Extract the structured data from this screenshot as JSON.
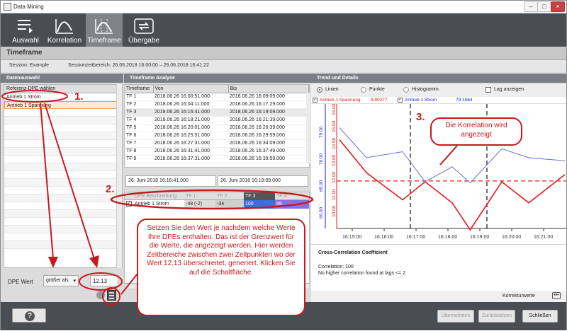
{
  "window": {
    "title": "Data Mining"
  },
  "toolbar": {
    "items": [
      {
        "label": "Auswahl"
      },
      {
        "label": "Korrelation"
      },
      {
        "label": "Timeframe"
      },
      {
        "label": "Übergabe"
      }
    ]
  },
  "page": {
    "title": "Timeframe"
  },
  "session": {
    "session_text": "Session: Example",
    "range_text": "Sessionzeitbereich: 26.06.2018 16:00:00 – 26.06.2018 16:41:22"
  },
  "left": {
    "title": "Datenauswahl",
    "column": "Referenz-DPE wählen",
    "items": [
      "Antrieb 1 Strom",
      "Antrieb 1 Spannung"
    ],
    "dpe_label": "DPE Wert",
    "operator_value": "größer als",
    "threshold_value": "12.13"
  },
  "middle": {
    "title": "Timeframe Analyse",
    "columns": [
      "Timeframe",
      "Von",
      "Bis"
    ],
    "rows": [
      [
        "TF 1",
        "2018.06.26 16:00:51.000",
        "2018.06.26 16:09:09.000"
      ],
      [
        "TF 2",
        "2018.06.26 16:04:11.000",
        "2018.06.26 16:17:29.000"
      ],
      [
        "TF 3",
        "2018.06.26 16:16:41.000",
        "2018.06.26 16:19:09.000"
      ],
      [
        "TF 4",
        "2018.06.26 16:18:21.000",
        "2018.06.26 16:21:39.000"
      ],
      [
        "TF 5",
        "2018.06.26 16:20:01.000",
        "2018.06.26 16:26:39.000"
      ],
      [
        "TF 6",
        "2018.06.26 16:25:51.000",
        "2018.06.26 16:29:59.000"
      ],
      [
        "TF 7",
        "2018.06.26 16:27:31.000",
        "2018.06.26 16:34:09.000"
      ],
      [
        "TF 8",
        "2018.06.26 16:31:41.000",
        "2018.06.26 16:37:49.000"
      ],
      [
        "TF 9",
        "2018.06.26 16:37:31.000",
        "2018.06.26 16:39:59.000"
      ]
    ],
    "date_from": "26. Juni 2018 16:16:41.000",
    "date_to": "26. Juni 2018 16:19:09.000",
    "dpe_columns": [
      "DPE Beschreibung",
      "TF 1",
      "TF 2",
      "TF 3",
      "TF 4"
    ],
    "dpe_row": [
      "Antrieb 1 Strom",
      "-48 (-2)",
      "-34",
      "100",
      "99"
    ]
  },
  "right": {
    "title": "Trend und Details",
    "radio": [
      "Linien",
      "Punkte",
      "Histogramm"
    ],
    "lag_label": "Lag anzeigen",
    "legend": [
      {
        "name": "Antrieb 1 Spannung",
        "value": "9.90277",
        "color": "#e8191e"
      },
      {
        "name": "Antrieb 1 Strom",
        "value": "79.1564",
        "color": "#1a1ad8"
      }
    ],
    "ccc_title": "Cross-Correlation Coefficient",
    "correlation": "Correlation: 100",
    "no_higher": "No higher correlation found at lags <= 2",
    "korrektur": "Korrekturwerte"
  },
  "chart_data": {
    "type": "line",
    "x": [
      "16:15:00",
      "16:16:00",
      "16:17:00",
      "16:18:00",
      "16:19:00",
      "16:20:00",
      "16:21:00"
    ],
    "y_ticks_red": [
      "16.00",
      "15.00",
      "14.00",
      "13.00",
      "12.00",
      "11.00",
      "10.00"
    ],
    "y_ticks_blue": [
      "75.00",
      "70.00",
      "65.00",
      "60.00"
    ],
    "threshold": 12.13,
    "series": [
      {
        "name": "Antrieb 1 Spannung",
        "color": "#e8191e",
        "points": [
          [
            0,
            50
          ],
          [
            12,
            105
          ],
          [
            28,
            150
          ],
          [
            38,
            120
          ],
          [
            50,
            155
          ],
          [
            58,
            200
          ],
          [
            72,
            120
          ],
          [
            84,
            155
          ],
          [
            100,
            108
          ]
        ]
      },
      {
        "name": "Antrieb 1 Strom",
        "color": "#6b6bd8",
        "points": [
          [
            0,
            30
          ],
          [
            12,
            80
          ],
          [
            28,
            70
          ],
          [
            38,
            120
          ],
          [
            50,
            95
          ],
          [
            58,
            122
          ],
          [
            72,
            65
          ],
          [
            84,
            80
          ],
          [
            100,
            85
          ]
        ]
      }
    ]
  },
  "annotations": {
    "n1": "1.",
    "n2": "2.",
    "n3": "3.",
    "callout_corr": "Die Korrelation wird angezeigt",
    "callout_main": "Setzen Sie den Wert je nachdem welche Werte Ihre DPEs enthalten. Das ist der Grenzwert für die Werte, die angezeigt werden. Hier werden Zeitbereiche zwischen zwei Zeitpunkten wo der Wert 12.13 überschreitet, generiert. Klicken Sie auf die Schaltfläche."
  },
  "buttons": {
    "help": "?",
    "apply": "Übernehmen",
    "reset": "Zurücksetzen",
    "close": "Schließen"
  }
}
